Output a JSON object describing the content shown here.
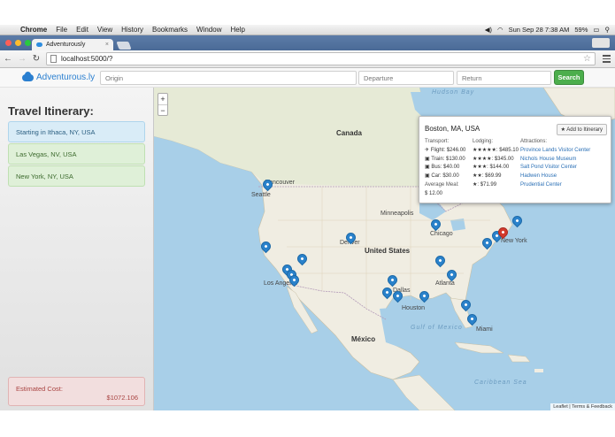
{
  "os_menubar": {
    "app": "Chrome",
    "items": [
      "File",
      "Edit",
      "View",
      "History",
      "Bookmarks",
      "Window",
      "Help"
    ],
    "battery": "59%",
    "clock": "Sun Sep 28  7:38 AM"
  },
  "browser": {
    "tab_title": "Adventurously",
    "url": "localhost:5000/?"
  },
  "app": {
    "brand": "Adventurous.ly",
    "origin_placeholder": "Origin",
    "departure_placeholder": "Departure",
    "return_placeholder": "Return",
    "search_label": "Search"
  },
  "itinerary": {
    "title": "Travel Itinerary:",
    "stops": [
      "Starting in Ithaca, NY, USA",
      "Las Vegas, NV, USA",
      "New York, NY, USA"
    ],
    "cost_label": "Estimated Cost:",
    "cost_value": "$1072.106"
  },
  "map": {
    "labels": {
      "hudson_bay": "Hudson Bay",
      "canada": "Canada",
      "united_states": "United States",
      "mexico": "México",
      "gulf": "Gulf of Mexico",
      "caribbean": "Caribbean Sea",
      "seattle": "Seattle",
      "vancouver": "Vancouver",
      "minneapolis": "Minneapolis",
      "chicago": "Chicago",
      "denver": "Denver",
      "los_angeles": "Los Angeles",
      "dallas": "Dallas",
      "houston": "Houston",
      "atlanta": "Atlanta",
      "miami": "Miami",
      "new_york": "New York"
    },
    "zoom_in": "+",
    "zoom_out": "−",
    "attribution": "Leaflet | Terms & Feedback"
  },
  "popup": {
    "title": "Boston, MA, USA",
    "add_label": "★ Add to Itinerary",
    "transport_header": "Transport:",
    "transport": [
      "✈ Flight: $246.00",
      "▣ Train: $130.00",
      "▣ Bus: $40.00",
      "▣ Car: $30.00"
    ],
    "meal_header": "Average Meal:",
    "meal": "$ 12.00",
    "lodging_header": "Lodging:",
    "lodging": [
      "★★★★★: $485.10",
      "★★★★: $345.00",
      "★★★: $144.00",
      "★★: $69.99",
      "★: $71.99"
    ],
    "attractions_header": "Attractions:",
    "attractions": [
      "Province Lands Visitor Center",
      "Nichols House Museum",
      "Salt Pond Visitor Center",
      "Hadwen House",
      "Prudential Center"
    ]
  }
}
